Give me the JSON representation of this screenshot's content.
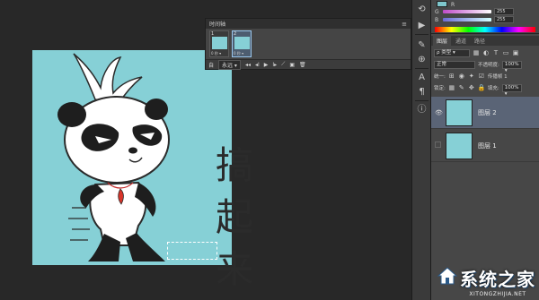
{
  "canvas": {
    "headline_chars": [
      "搞",
      "起",
      "来"
    ]
  },
  "timeline": {
    "title": "时间轴",
    "menu_icon": "≡",
    "frames": [
      {
        "number": "1",
        "delay": "0 秒 ▾",
        "active": false
      },
      {
        "number": "2",
        "delay": "0 秒 ▾",
        "active": true
      }
    ],
    "controls": {
      "loop_icon": "自",
      "loop_value": "永远 ▾",
      "first_frame": "◂◂",
      "prev_frame": "◂I",
      "play": "▶",
      "next_frame": "I▸",
      "tween": "⟋",
      "duplicate": "▣",
      "delete": "🗑"
    }
  },
  "color_panel": {
    "channels": [
      {
        "label": "R",
        "value": "",
        "gradient": "linear-gradient(90deg,#00ffff,#ffffff)"
      },
      {
        "label": "G",
        "value": "255",
        "gradient": "linear-gradient(90deg,#c04cc9,#ffffff)"
      },
      {
        "label": "B",
        "value": "255",
        "gradient": "linear-gradient(90deg,#6b6bd6,#d5ffff)"
      }
    ],
    "swatch_color": "#7ec6cc"
  },
  "layers_panel": {
    "tabs": [
      "图层",
      "通道",
      "路径"
    ],
    "active_tab": "图层",
    "filter_kind": "ρ 类型 ▾",
    "blend_mode": "正常",
    "opacity_label": "不透明度:",
    "opacity_value": "100% ▾",
    "unify_label": "统一:",
    "propagate_label": "传播帧 1",
    "lock_label": "锁定:",
    "fill_label": "填充:",
    "fill_value": "100% ▾",
    "layers": [
      {
        "name": "图层 2",
        "visible": true,
        "selected": true
      },
      {
        "name": "图层 1",
        "visible": false,
        "selected": false
      }
    ]
  },
  "watermark": {
    "main": "系统之家",
    "sub": "XITONGZHIJIA.NET"
  },
  "colors": {
    "artboard_bg": "#86d0d6",
    "workspace_bg": "#282828",
    "panel_bg": "#474747",
    "selected_layer_bg": "#5a6476"
  }
}
